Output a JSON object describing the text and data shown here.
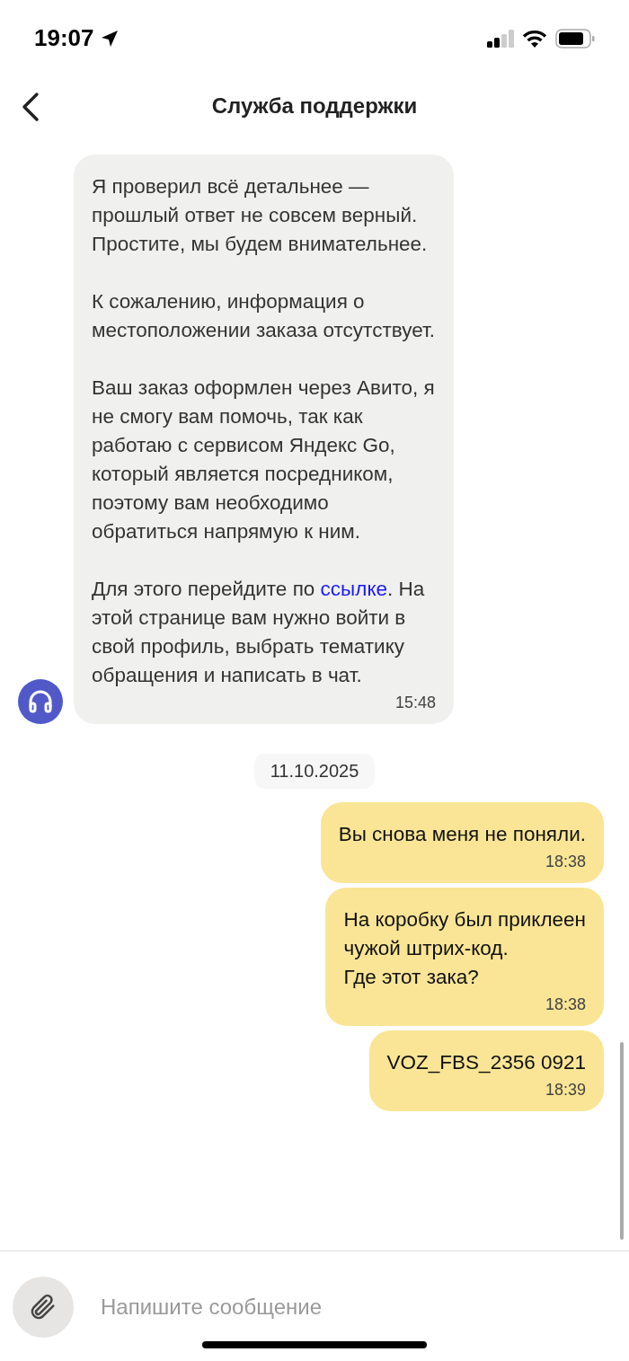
{
  "status_bar": {
    "time": "19:07"
  },
  "header": {
    "title": "Служба поддержки"
  },
  "messages": [
    {
      "kind": "incoming",
      "paragraphs": [
        {
          "text": "Я проверил всё детальнее — прошлый ответ не совсем верный. Простите, мы будем внимательнее."
        },
        {
          "text": "К сожалению, информация о местоположении заказа отсутствует."
        },
        {
          "text": "Ваш заказ оформлен через Авито, я не смогу вам помочь, так как работаю с сервисом Яндекс Go, который является посредником, поэтому вам необходимо обратиться напрямую к ним."
        },
        {
          "text": "Для этого перейдите по ",
          "link": "ссылке",
          "after": ". На этой странице вам нужно войти в свой профиль, выбрать тематику обращения и написать в чат."
        }
      ],
      "time": "15:48"
    },
    {
      "kind": "date",
      "text": "11.10.2025"
    },
    {
      "kind": "outgoing",
      "paragraphs": [
        {
          "text": "Вы снова меня не поняли."
        }
      ],
      "time": "18:38"
    },
    {
      "kind": "outgoing",
      "paragraphs": [
        {
          "text": "На коробку был приклеен\nчужой штрих-код.\nГде этот зака?"
        }
      ],
      "time": "18:38"
    },
    {
      "kind": "outgoing",
      "paragraphs": [
        {
          "text": "VOZ_FBS_2356 0921"
        }
      ],
      "time": "18:39"
    }
  ],
  "composer": {
    "placeholder": "Напишите сообщение"
  }
}
